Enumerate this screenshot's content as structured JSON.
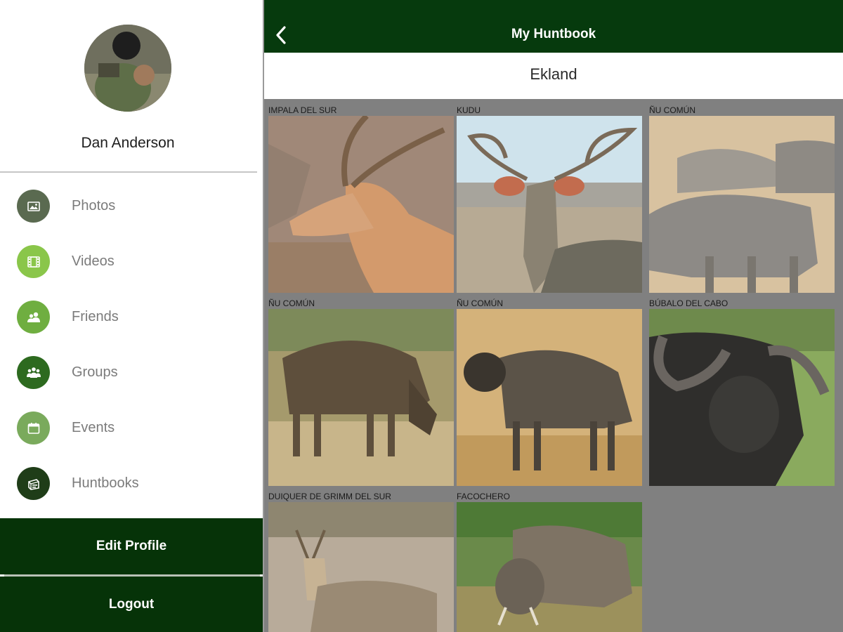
{
  "header": {
    "title": "My Huntbook",
    "subtitle": "Ekland"
  },
  "profile": {
    "name": "Dan Anderson"
  },
  "sidebar": {
    "items": [
      {
        "label": "Photos",
        "icon": "photo-icon",
        "color": "#5a6a50"
      },
      {
        "label": "Videos",
        "icon": "film-icon",
        "color": "#8ac64a"
      },
      {
        "label": "Friends",
        "icon": "friends-icon",
        "color": "#6fae40"
      },
      {
        "label": "Groups",
        "icon": "groups-icon",
        "color": "#2d6a1f"
      },
      {
        "label": "Events",
        "icon": "calendar-icon",
        "color": "#7aaa5c"
      },
      {
        "label": "Huntbooks",
        "icon": "book-icon",
        "color": "#1f3d18"
      }
    ]
  },
  "actions": {
    "edit_profile": "Edit Profile",
    "logout": "Logout"
  },
  "gallery": {
    "items": [
      {
        "label": "IMPALA DEL SUR"
      },
      {
        "label": "KUDU"
      },
      {
        "label": "ÑU COMÚN"
      },
      {
        "label": "ÑU COMÚN"
      },
      {
        "label": "ÑU COMÚN"
      },
      {
        "label": "BÚBALO DEL CABO"
      },
      {
        "label": "DUIQUER DE GRIMM DEL SUR"
      },
      {
        "label": "FACOCHERO"
      }
    ]
  },
  "colors": {
    "header_bg": "#063a0d",
    "button_bg": "#063308",
    "gallery_bg": "#808080"
  }
}
